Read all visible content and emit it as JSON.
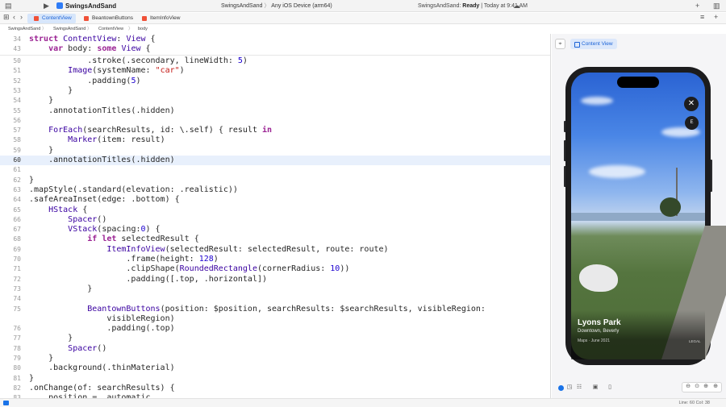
{
  "titlebar": {
    "project": "SwingsAndSand",
    "scheme": "SwingsAndSand",
    "destination": "Any iOS Device (arm64)",
    "status_project": "SwingsAndSand:",
    "status_state": "Ready",
    "status_time": "| Today at 9:41 AM"
  },
  "tabs": [
    "ContentView",
    "BeantownButtons",
    "ItemInfoView"
  ],
  "breadcrumb": [
    "SwingsAndSand",
    "SwingsAndSand",
    "ContentView",
    "body"
  ],
  "sticky": [
    {
      "n": "34",
      "text": "struct ContentView: View {"
    },
    {
      "n": "43",
      "text": "    var body: some View {"
    }
  ],
  "code": [
    {
      "n": "50",
      "text": "            .stroke(.secondary, lineWidth: 5)"
    },
    {
      "n": "51",
      "text": "        Image(systemName: \"car\")"
    },
    {
      "n": "52",
      "text": "            .padding(5)"
    },
    {
      "n": "53",
      "text": "        }"
    },
    {
      "n": "54",
      "text": "    }"
    },
    {
      "n": "55",
      "text": "    .annotationTitles(.hidden)"
    },
    {
      "n": "56",
      "text": ""
    },
    {
      "n": "57",
      "text": "    ForEach(searchResults, id: \\.self) { result in"
    },
    {
      "n": "58",
      "text": "        Marker(item: result)"
    },
    {
      "n": "59",
      "text": "    }"
    },
    {
      "n": "60",
      "text": "    .annotationTitles(.hidden)"
    },
    {
      "n": "61",
      "text": ""
    },
    {
      "n": "62",
      "text": "}"
    },
    {
      "n": "63",
      "text": ".mapStyle(.standard(elevation: .realistic))"
    },
    {
      "n": "64",
      "text": ".safeAreaInset(edge: .bottom) {"
    },
    {
      "n": "65",
      "text": "    HStack {"
    },
    {
      "n": "66",
      "text": "        Spacer()"
    },
    {
      "n": "67",
      "text": "        VStack(spacing:0) {"
    },
    {
      "n": "68",
      "text": "            if let selectedResult {"
    },
    {
      "n": "69",
      "text": "                ItemInfoView(selectedResult: selectedResult, route: route)"
    },
    {
      "n": "70",
      "text": "                    .frame(height: 128)"
    },
    {
      "n": "71",
      "text": "                    .clipShape(RoundedRectangle(cornerRadius: 10))"
    },
    {
      "n": "72",
      "text": "                    .padding([.top, .horizontal])"
    },
    {
      "n": "73",
      "text": "            }"
    },
    {
      "n": "74",
      "text": ""
    },
    {
      "n": "75",
      "text": "            BeantownButtons(position: $position, searchResults: $searchResults, visibleRegion:"
    },
    {
      "n": "",
      "text": "                visibleRegion)"
    },
    {
      "n": "76",
      "text": "                .padding(.top)"
    },
    {
      "n": "77",
      "text": "        }"
    },
    {
      "n": "78",
      "text": "        Spacer()"
    },
    {
      "n": "79",
      "text": "    }"
    },
    {
      "n": "80",
      "text": "    .background(.thinMaterial)"
    },
    {
      "n": "81",
      "text": "}"
    },
    {
      "n": "82",
      "text": ".onChange(of: searchResults) {"
    },
    {
      "n": "83",
      "text": "    position = .automatic"
    }
  ],
  "highlight_line": "60",
  "canvas": {
    "preview_label": "Content View",
    "place_name": "Lyons Park",
    "place_subtitle": "Downtown, Beverly",
    "place_meta": "Maps · June 2021",
    "place_badge": "LEGAL",
    "direction_badge": "E"
  },
  "status": {
    "position": "Line: 60  Col: 38"
  },
  "colors": {
    "accent": "#1a73e8",
    "keyword": "#9b2393",
    "type": "#3900a0",
    "string": "#c41a16",
    "number": "#1c00cf",
    "highlight": "#e8f0fc"
  }
}
